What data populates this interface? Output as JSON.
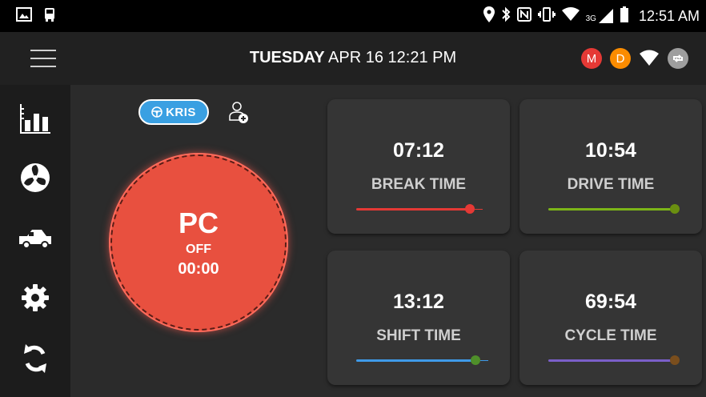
{
  "status_bar": {
    "time": "12:51 AM",
    "network": "3G",
    "left_icons": [
      "image-notification-icon",
      "bus-notification-icon"
    ],
    "right_icons": [
      "location-icon",
      "bluetooth-icon",
      "nfc-icon",
      "vibrate-icon",
      "wifi-icon",
      "signal-icon",
      "battery-icon"
    ]
  },
  "header": {
    "day": "TUESDAY",
    "date_time": " APR 16 12:21 PM",
    "badges": [
      {
        "letter": "M",
        "color": "#e53935"
      },
      {
        "letter": "D",
        "color": "#fb8c00"
      }
    ],
    "icons": [
      "menu-icon",
      "wifi-icon",
      "sync-status-icon"
    ]
  },
  "sidebar": {
    "items": [
      {
        "name": "reports",
        "icon": "bar-chart-icon"
      },
      {
        "name": "inspection",
        "icon": "fan-icon"
      },
      {
        "name": "vehicle",
        "icon": "truck-icon"
      },
      {
        "name": "settings",
        "icon": "gear-icon"
      },
      {
        "name": "sync",
        "icon": "refresh-icon"
      }
    ]
  },
  "driver": {
    "name": "KRIS",
    "icon": "steering-wheel-icon",
    "add_icon": "add-codriver-icon",
    "color": "#3aa0e2"
  },
  "duty_status": {
    "code": "PC",
    "state": "OFF",
    "timer": "00:00",
    "color": "#e8503f"
  },
  "timers": [
    {
      "label": "BREAK TIME",
      "value": "07:12",
      "color": "#e53935",
      "progress": 0.9
    },
    {
      "label": "DRIVE TIME",
      "value": "10:54",
      "color": "#7cb518",
      "progress": 1.0
    },
    {
      "label": "SHIFT TIME",
      "value": "13:12",
      "color": "#3f9ae8",
      "progress": 0.94
    },
    {
      "label": "CYCLE TIME",
      "value": "69:54",
      "color": "#7b5fc9",
      "progress": 1.0
    }
  ]
}
